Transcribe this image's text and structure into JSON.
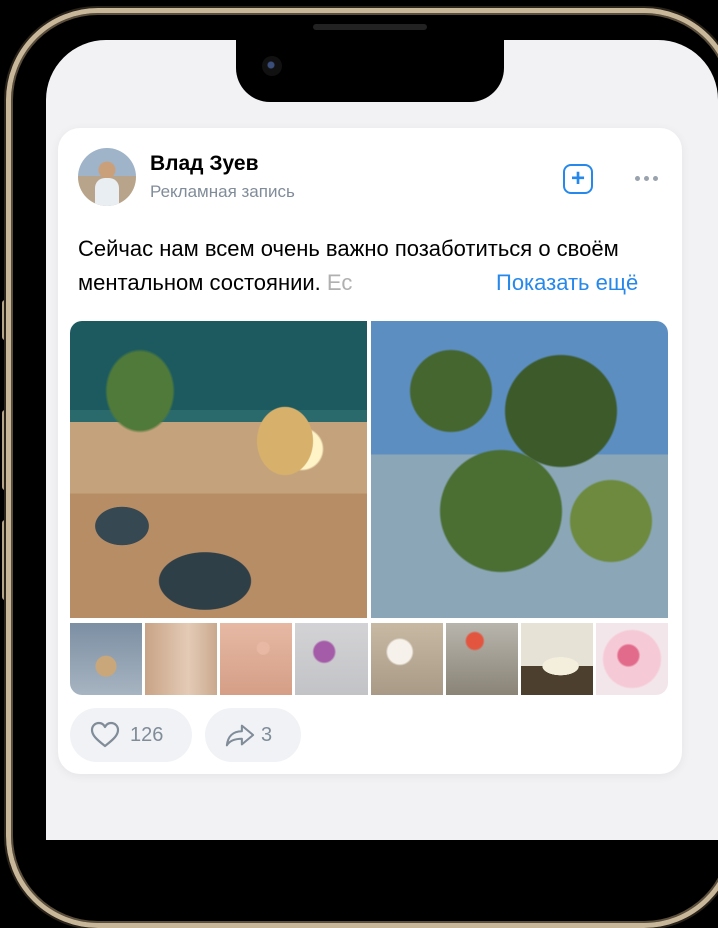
{
  "post": {
    "author": "Влад Зуев",
    "subtitle": "Рекламная запись",
    "text_main": "Сейчас нам всем очень важно позаботиться о своём ментальном состоянии.",
    "text_fade": "Ес",
    "show_more": "Показать ещё",
    "likes": "126",
    "shares": "3"
  },
  "icons": {
    "add": "plus-square-icon",
    "more": "more-horizontal-icon",
    "like": "heart-outline-icon",
    "share": "share-arrow-icon"
  },
  "colors": {
    "accent": "#2688eb",
    "secondary_text": "#818c99",
    "action_bg": "#f0f2f5",
    "screen_bg": "#f2f2f4",
    "frame_gold": "#c9b79a"
  }
}
